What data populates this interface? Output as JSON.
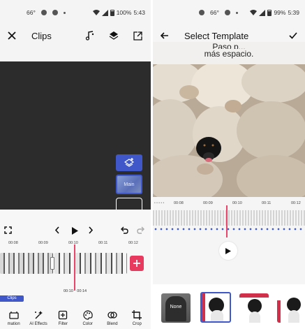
{
  "left": {
    "status": {
      "temp": "66°",
      "battery": "100%",
      "time": "5:43"
    },
    "appbar": {
      "title": "Clips",
      "close_icon": "close-icon",
      "actions": [
        "music-note-icon",
        "layers-icon",
        "export-icon"
      ]
    },
    "preview": {
      "main_label": "Main"
    },
    "timeline": {
      "ruler_labels": [
        "00:08",
        "00:09",
        "00:10",
        "00:11",
        "00:12"
      ],
      "current_time": "00:10",
      "total_time": "00:14",
      "clips_tag": "Clips"
    },
    "toolbar": [
      {
        "label": "mation",
        "icon": "animation-icon"
      },
      {
        "label": "AI Effects",
        "icon": "ai-effects-icon"
      },
      {
        "label": "Filter",
        "icon": "filter-icon"
      },
      {
        "label": "Color",
        "icon": "palette-icon"
      },
      {
        "label": "Blend",
        "icon": "blend-icon"
      },
      {
        "label": "Crop",
        "icon": "crop-icon"
      }
    ]
  },
  "right": {
    "status": {
      "temp": "66°",
      "battery": "99%",
      "time": "5:39"
    },
    "appbar": {
      "title": "Select Template",
      "back_icon": "arrow-back-icon",
      "confirm_icon": "check-icon"
    },
    "caption": {
      "line1": "Paso p...",
      "line2": "más espacio."
    },
    "waveform": {
      "ruler_labels": [
        "00:08",
        "00:09",
        "00:10",
        "00:11",
        "00:12"
      ]
    },
    "templates": [
      {
        "label": "None"
      },
      {
        "label": ""
      },
      {
        "label": ""
      },
      {
        "label": ""
      }
    ]
  },
  "colors": {
    "accent_blue": "#3f57c8",
    "playhead_pink": "#e8456b",
    "preview_bg": "#2c2c2c",
    "add_button": "#e83a5f"
  }
}
